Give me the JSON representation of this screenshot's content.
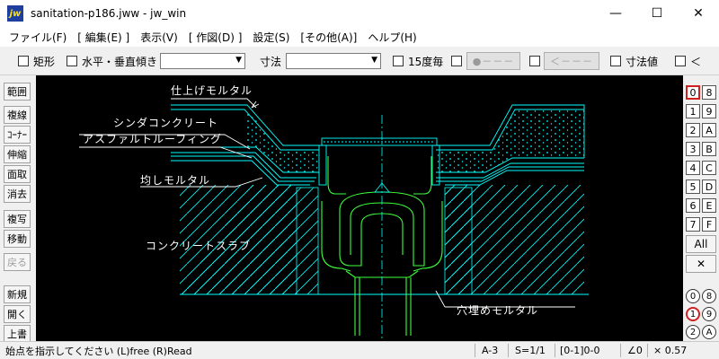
{
  "window": {
    "title": "sanitation-p186.jww - jw_win",
    "app_icon_text": "jw",
    "minimize": "—",
    "maximize": "☐",
    "close": "✕"
  },
  "menu": [
    "ファイル(F)",
    "[ 編集(E) ]",
    "表示(V)",
    "[ 作図(D) ]",
    "設定(S)",
    "[その他(A)]",
    "ヘルプ(H)"
  ],
  "toolbar": {
    "rect_label": "矩形",
    "hv_label": "水平・垂直",
    "tilt_label": "傾き",
    "tilt_value": "",
    "dim_label": "寸法",
    "dim_value": "",
    "deg15_label": "15度毎",
    "btn_circle": "●－－－",
    "btn_arrow": "＜－－－",
    "dimval_label": "寸法値",
    "lt_label": "＜"
  },
  "left_tools": [
    "範囲",
    "複線",
    "ｺｰﾅｰ",
    "伸縮",
    "面取",
    "消去",
    "複写",
    "移動",
    "戻る",
    "新規",
    "開く",
    "上書"
  ],
  "drawing": {
    "labels": {
      "finish_mortar": "仕上げモルタル",
      "cinder_concrete": "シンダコンクリート",
      "asphalt_roofing": "アスファルトルーフィング",
      "leveling_mortar": "均しモルタル",
      "concrete_slab": "コンクリートスラブ",
      "hole_mortar": "穴埋めモルタル"
    }
  },
  "layers": {
    "left": [
      "0",
      "1",
      "2",
      "3",
      "4",
      "5",
      "6",
      "7"
    ],
    "right": [
      "8",
      "9",
      "A",
      "B",
      "C",
      "D",
      "E",
      "F"
    ],
    "active": "0",
    "all_label": "All",
    "x_label": "✕",
    "groups_left": [
      "0",
      "1",
      "2"
    ],
    "groups_right": [
      "8",
      "9",
      "A"
    ],
    "active_group": "1"
  },
  "status": {
    "message": "始点を指示してください (L)free (R)Read",
    "paper": "A-3",
    "scale": "S=1/1",
    "layer": "[0-1]0-0",
    "angle": "∠0",
    "factor": "× 0.57"
  },
  "colors": {
    "canvas_bg": "#000000",
    "cyan": "#00ffff",
    "green": "#3cff3c",
    "white": "#ffffff",
    "active_layer": "#d02020"
  }
}
